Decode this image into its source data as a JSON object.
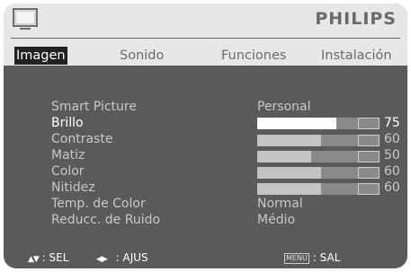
{
  "brand": "PHILIPS",
  "tabs": [
    {
      "label": "Imagen",
      "active": true
    },
    {
      "label": "Sonido",
      "active": false
    },
    {
      "label": "Funciones",
      "active": false
    },
    {
      "label": "Instalación",
      "active": false
    }
  ],
  "settings": [
    {
      "label": "Smart Picture",
      "value": "Personal"
    },
    {
      "label": "Brillo",
      "level": 75,
      "level_text": "75",
      "selected": true
    },
    {
      "label": "Contraste",
      "level": 60,
      "level_text": "60"
    },
    {
      "label": "Matiz",
      "level": 50,
      "level_text": "50"
    },
    {
      "label": "Color",
      "level": 60,
      "level_text": "60"
    },
    {
      "label": "Nitidez",
      "level": 60,
      "level_text": "60"
    },
    {
      "label": "Temp. de Color",
      "value": "Normal"
    },
    {
      "label": "Reducc. de Ruido",
      "value": "Médio"
    }
  ],
  "footer": {
    "select_arrows": "▲▼",
    "select_label": ": SEL",
    "adjust_arrows": "◀▶",
    "adjust_label": ": AJUS",
    "menu_key": "MENU",
    "exit_label": ": SAL"
  },
  "colors": {
    "panel_bg": "#5a5a5a",
    "header_bg": "#e7e7e7",
    "active_tab_bg": "#222222",
    "slider_track": "#8a8a8a",
    "slider_fill": "#c4c4c4",
    "slider_fill_active": "#ffffff"
  },
  "icons": {
    "tv": "tv-icon",
    "up_down": "up-down-arrows-icon",
    "left_right": "left-right-arrows-icon",
    "menu": "menu-key-icon"
  }
}
